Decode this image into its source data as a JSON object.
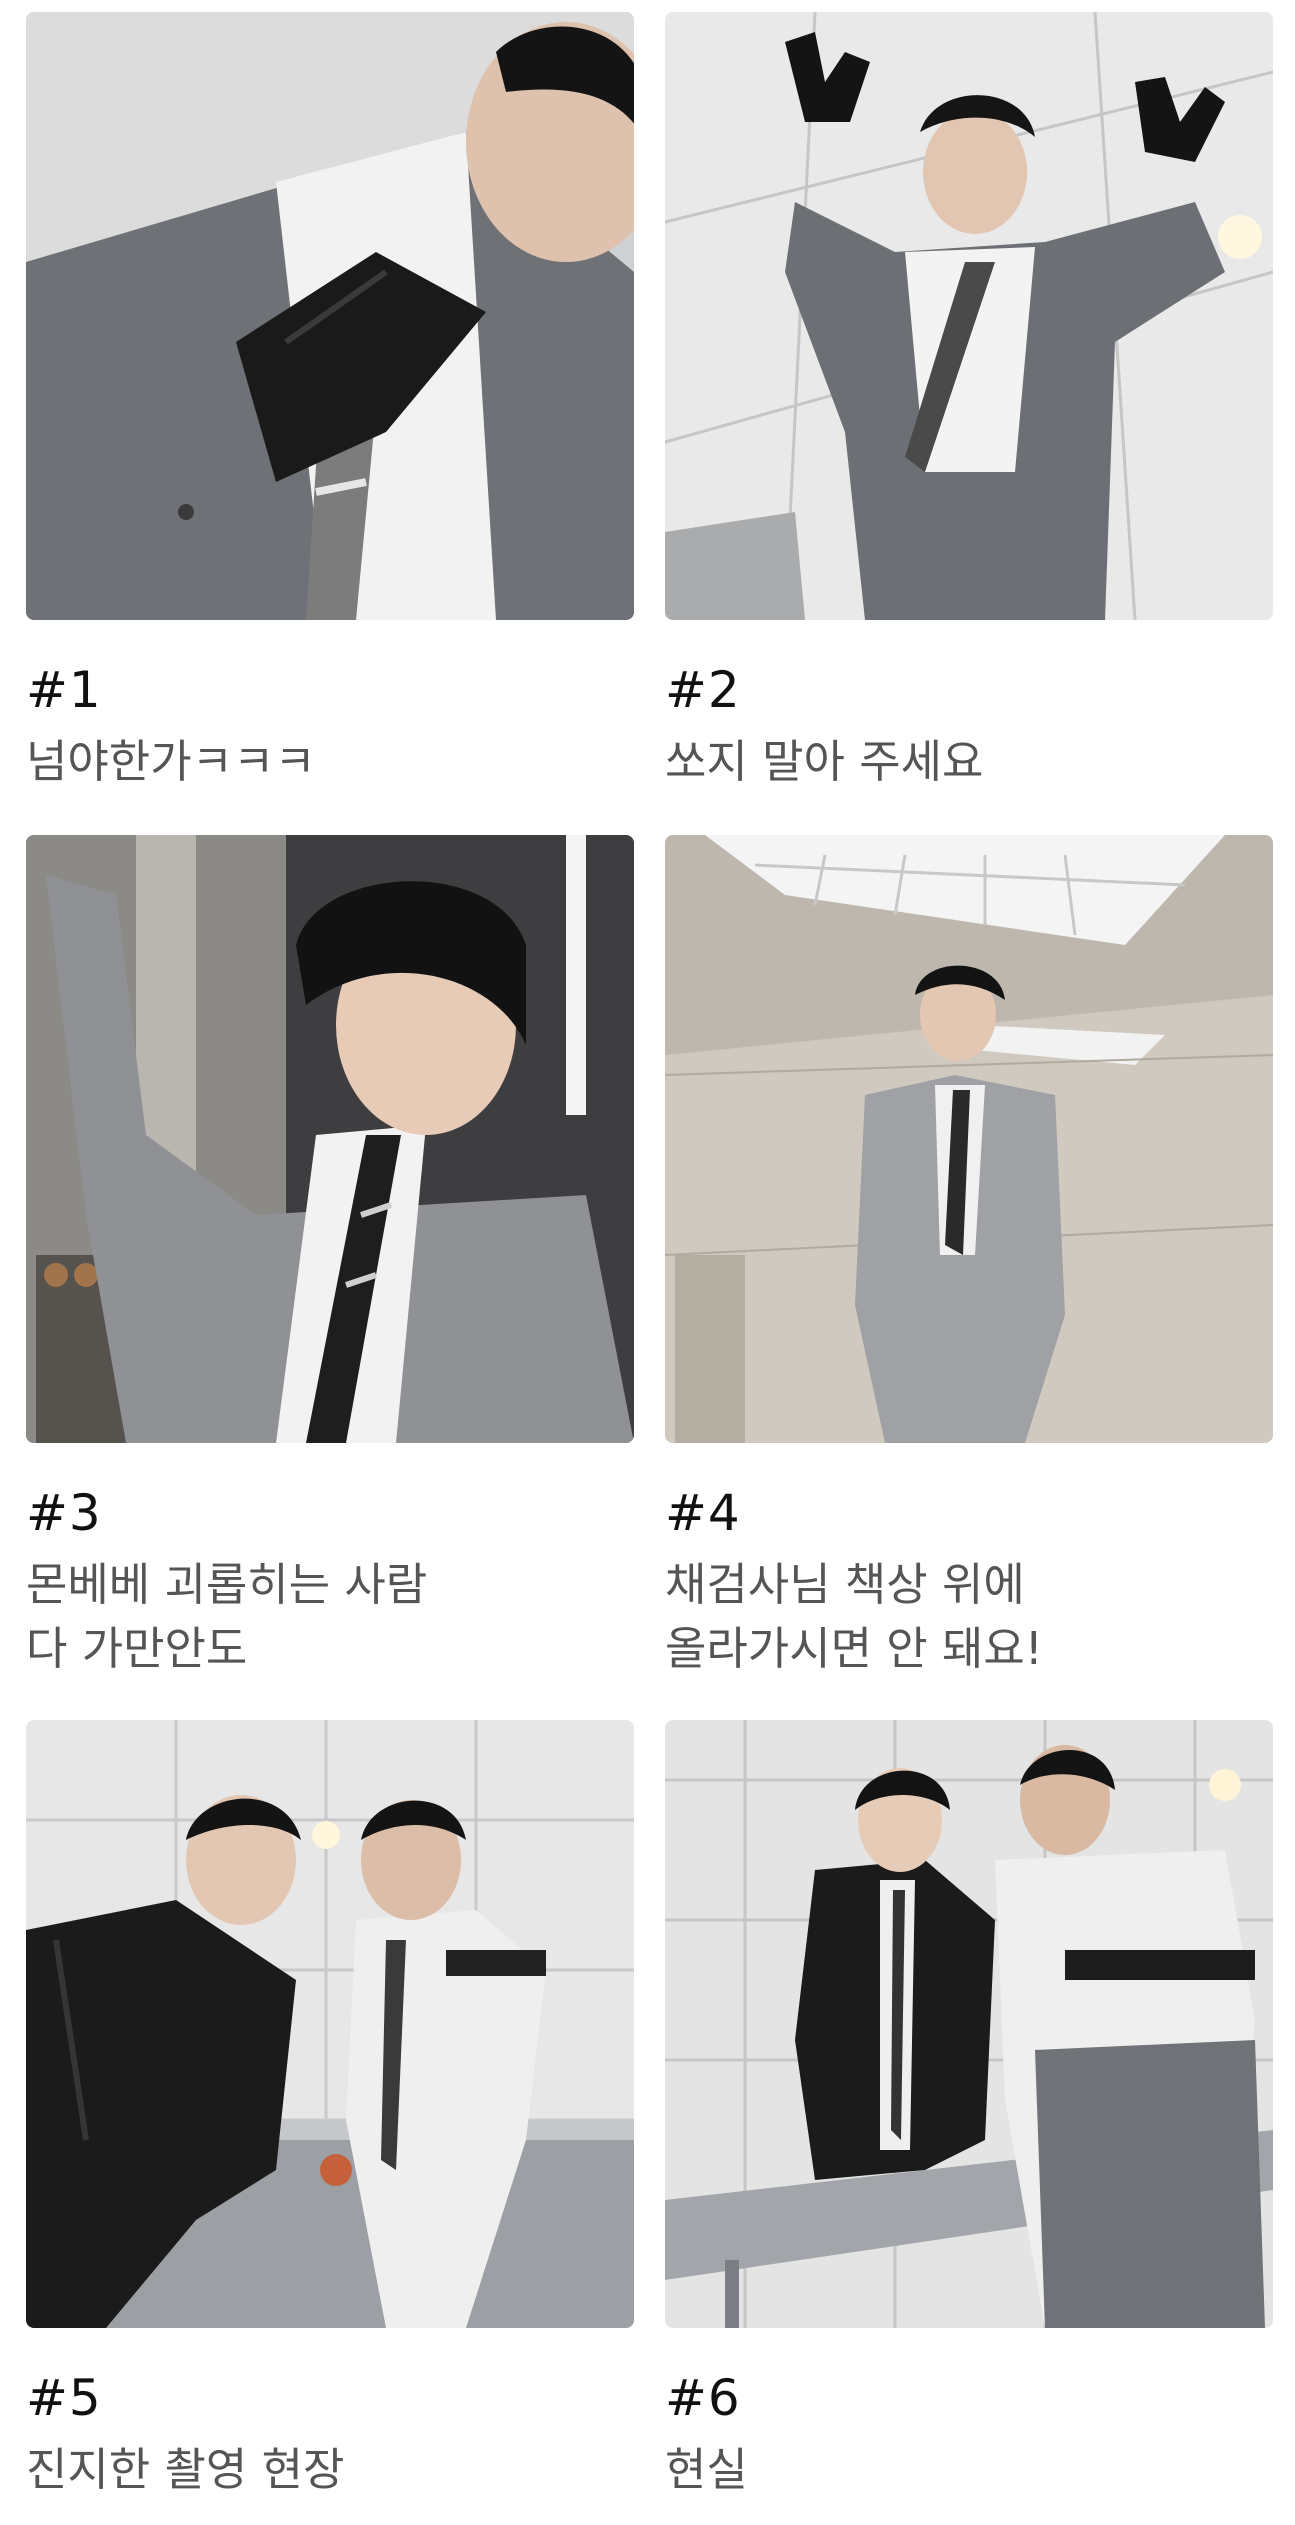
{
  "posts": [
    {
      "number": "#1",
      "caption": "넘야한가ㅋㅋㅋ",
      "photo_icon": "photo-glove-closeup"
    },
    {
      "number": "#2",
      "caption": "쏘지 말아 주세요",
      "photo_icon": "photo-hands-up"
    },
    {
      "number": "#3",
      "caption": "몬베베 괴롭히는 사람\n다 가만안도",
      "photo_icon": "photo-profile-window"
    },
    {
      "number": "#4",
      "caption": "채검사님 책상 위에\n올라가시면 안 돼요!",
      "photo_icon": "photo-standing-room"
    },
    {
      "number": "#5",
      "caption": "진지한 촬영 현장",
      "photo_icon": "photo-two-men-table"
    },
    {
      "number": "#6",
      "caption": "현실",
      "photo_icon": "photo-two-men-laughing"
    }
  ],
  "colors": {
    "background": "#ffffff",
    "number_text": "#111111",
    "caption_text": "#555555",
    "wall": "#e6e6e6",
    "suit_gray": "#6f7276",
    "leather": "#1c1c1c"
  }
}
